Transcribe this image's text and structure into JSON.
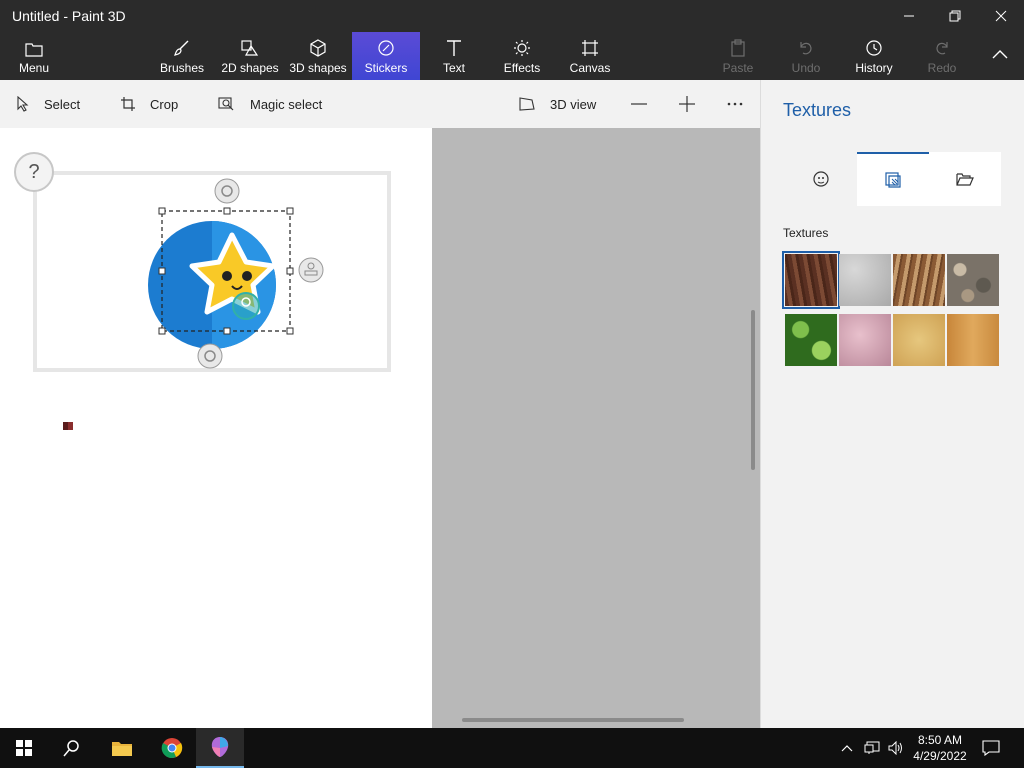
{
  "window": {
    "title": "Untitled - Paint 3D"
  },
  "ribbon": {
    "menu": "Menu",
    "brushes": "Brushes",
    "shapes2d": "2D shapes",
    "shapes3d": "3D shapes",
    "stickers": "Stickers",
    "text": "Text",
    "effects": "Effects",
    "canvas": "Canvas",
    "paste": "Paste",
    "undo": "Undo",
    "history": "History",
    "redo": "Redo"
  },
  "toolbar": {
    "select": "Select",
    "crop": "Crop",
    "magic_select": "Magic select",
    "view3d": "3D view"
  },
  "canvas": {
    "help": "?"
  },
  "side_panel": {
    "title": "Textures",
    "section_label": "Textures",
    "textures": [
      {
        "name": "bark",
        "color": "#6b3e2a"
      },
      {
        "name": "granite",
        "color": "#b9b9b9"
      },
      {
        "name": "wood-grain",
        "color": "#a9774a"
      },
      {
        "name": "pebbles",
        "color": "#8a8070"
      },
      {
        "name": "leaves",
        "color": "#4f8d2e"
      },
      {
        "name": "pink-marble",
        "color": "#d3a3b3"
      },
      {
        "name": "sand",
        "color": "#d9b366"
      },
      {
        "name": "light-wood",
        "color": "#cf9447"
      }
    ]
  },
  "taskbar": {
    "time": "8:50 AM",
    "date": "4/29/2022"
  },
  "colors": {
    "accent": "#1f5fa8",
    "sticker_active": "#4b47d6"
  }
}
